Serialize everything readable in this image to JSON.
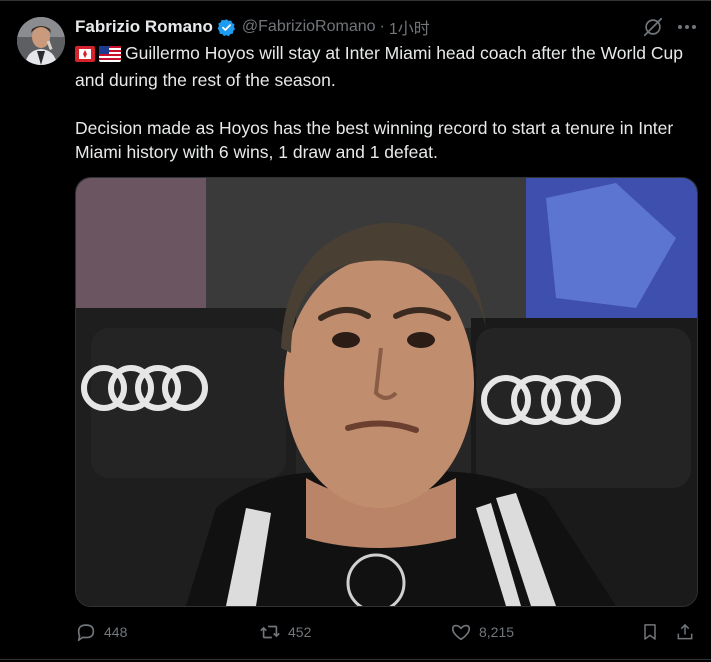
{
  "post": {
    "author_name": "Fabrizio Romano",
    "handle": "@FabrizioRomano",
    "separator": "·",
    "time": "1小时",
    "verified": true,
    "text_line_1": "Guillermo Hoyos will stay at Inter Miami head coach after the World Cup and during the rest of the season.",
    "text_line_2": "Decision made as Hoyos has the best winning record to start a tenure in Inter Miami history with 6 wins, 1 draw and 1 defeat.",
    "flags": [
      "flag-red-white-icon",
      "flag-usa-icon"
    ]
  },
  "media": {
    "kind": "photo",
    "visible_logos": [
      "audi-rings-logo",
      "audi-rings-logo"
    ],
    "background_color": "#2a2a2a"
  },
  "actions": {
    "reply_count": "448",
    "repost_count": "452",
    "like_count": "8,215"
  },
  "colors": {
    "background": "#000000",
    "text_primary": "#e7e9ea",
    "text_secondary": "#71767b",
    "verified_blue": "#1d9bf0",
    "divider": "#2f3336"
  }
}
